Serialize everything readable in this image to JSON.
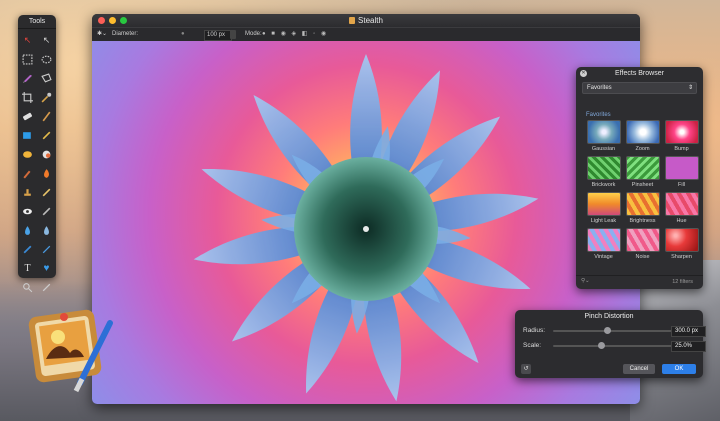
{
  "tools_panel": {
    "title": "Tools",
    "items": [
      "arrow-red-icon",
      "move-arrow-icon",
      "rect-select-icon",
      "ellipse-select-icon",
      "lasso-icon",
      "polygon-lasso-icon",
      "crop-icon",
      "eyedropper-icon",
      "eraser-icon",
      "brush-icon",
      "fill-bucket-icon",
      "pencil-icon",
      "shape-rect-icon",
      "gear-icon",
      "smudge-icon",
      "sponge-icon",
      "burn-icon",
      "flame-icon",
      "clone-stamp-icon",
      "pen-tool-icon",
      "eye-icon",
      "dodge-icon",
      "drop-icon",
      "blur-drop-icon",
      "bandage-icon",
      "line-icon",
      "text-tool-icon",
      "color-swatch-icon",
      "zoom-icon",
      "hand-icon"
    ]
  },
  "window": {
    "title": "Stealth",
    "toolbar": {
      "diameter_label": "Diameter:",
      "diameter_value": "100 px",
      "mode_label": "Mode:"
    }
  },
  "effects_browser": {
    "title": "Effects Browser",
    "category": "Favorites",
    "section": "Favorites",
    "filters": [
      {
        "name": "Gaussian"
      },
      {
        "name": "Zoom"
      },
      {
        "name": "Bump"
      },
      {
        "name": "Brickwork"
      },
      {
        "name": "Pinsheet"
      },
      {
        "name": "Fill"
      },
      {
        "name": "Light Leak"
      },
      {
        "name": "Brightness"
      },
      {
        "name": "Hue"
      },
      {
        "name": "Vintage"
      },
      {
        "name": "Noise"
      },
      {
        "name": "Sharpen"
      }
    ],
    "count": "12 filters"
  },
  "pinch_panel": {
    "title": "Pinch Distortion",
    "radius_label": "Radius:",
    "radius_value": "300.0 px",
    "radius_level": 0.45,
    "scale_label": "Scale:",
    "scale_value": "25.0%",
    "scale_level": 0.4,
    "cancel_label": "Cancel",
    "ok_label": "OK"
  },
  "colors": {
    "accent": "#2d7fe8",
    "close": "#fc5f57",
    "minimize": "#fdbc2e",
    "zoom": "#28c840"
  }
}
